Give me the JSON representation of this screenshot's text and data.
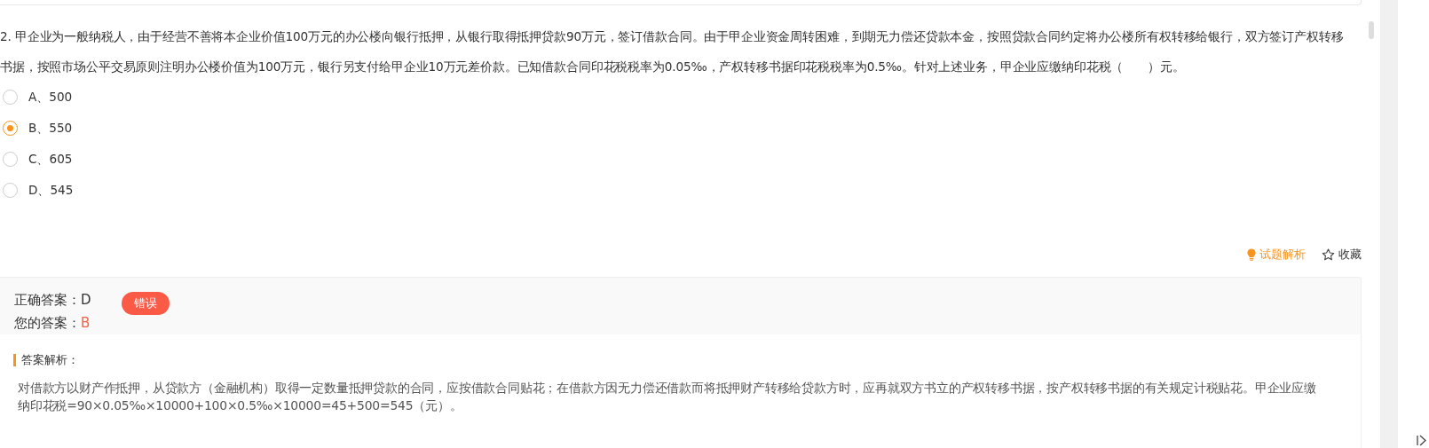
{
  "question": {
    "lines": [
      "2. 甲企业为一般纳税人，由于经营不善将本企业价值100万元的办公楼向银行抵押，从银行取得抵押贷款90万元，签订借款合同。由于甲企业资金周转困难，到期无力偿还贷款本金，按照贷款合同约定将办公楼所有权转移给银行，双方签订产权转移",
      "书据，按照市场公平交易原则注明办公楼价值为100万元，银行另支付给甲企业10万元差价款。已知借款合同印花税税率为0.05‰，产权转移书据印花税税率为0.5‰。针对上述业务，甲企业应缴纳印花税（　　）元。"
    ]
  },
  "options": [
    {
      "label": "A、500",
      "selected": false
    },
    {
      "label": "B、550",
      "selected": true
    },
    {
      "label": "C、605",
      "selected": false
    },
    {
      "label": "D、545",
      "selected": false
    }
  ],
  "actions": [
    {
      "kind": "analysis",
      "label": "试题解析"
    },
    {
      "kind": "favorite",
      "label": "收藏"
    }
  ],
  "result": {
    "correct_label": "正确答案：",
    "correct_value": "D",
    "your_label": "您的答案：",
    "your_value": "B",
    "is_correct": false,
    "badge": "错误"
  },
  "explanation": {
    "title": "答案解析：",
    "lines": [
      "对借款方以财产作抵押，从贷款方（金融机构）取得一定数量抵押贷款的合同，应按借款合同贴花；在借款方因无力偿还借款而将抵押财产转移给贷款方时，应再就双方书立的产权转移书据，按产权转移书据的有关规定计税贴花。甲企业应缴",
      "纳印花税=90×0.05‰×10000+100×0.5‰×10000=45+500=545（元）。"
    ]
  }
}
